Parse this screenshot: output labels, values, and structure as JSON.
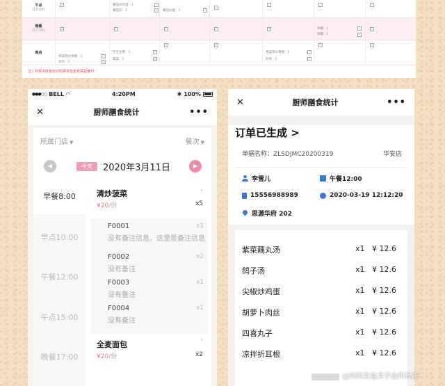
{
  "top_table": {
    "rows": [
      {
        "label": "午点",
        "sub": "(15:00)",
        "pink": false
      },
      {
        "label": "晚餐",
        "sub": "(17:00)",
        "pink": true
      },
      {
        "label": "晚点",
        "sub": "",
        "pink": false
      }
    ],
    "snippets": {
      "r1a": "蕃茄炒鸡蛋：1",
      "r1b": "番茄饮：1",
      "r1c": "番茄炒蛋：1",
      "r2a": "早餐：1",
      "r2b": "早餐：1",
      "r3a": "青菜肉炒青椒：1",
      "r3b": "炒鸡：1",
      "r3c": "天玉豆芽：1",
      "r3d": "蔬菜：1",
      "r3e": "青菜肉炒青椒：1",
      "r3f": "炒青：1"
    },
    "note": "注：列表中红色标识的菜单包含有禁忌食材"
  },
  "left_phone": {
    "status": {
      "carrier": "BELL",
      "time": "4:20PM",
      "battery": "100%"
    },
    "title": "厨师膳食统计",
    "store_filter": "所属门店",
    "meal_filter": "餐次",
    "today_label": "今天",
    "date": "2020年3月11日",
    "meals": [
      "早餐8:00",
      "早点10:00",
      "午餐12:00",
      "午点15:00",
      "晚餐17:00"
    ],
    "dishes": [
      {
        "name": "清炒菠菜",
        "price": "¥20",
        "unit": "/份",
        "qty": "x5",
        "orders": [
          {
            "code": "F0001",
            "note": "没有备注信息，这里是备注信息",
            "qty": "x1"
          },
          {
            "code": "F0002",
            "note": "没有备注",
            "qty": "x2"
          },
          {
            "code": "F0003",
            "note": "没有备注",
            "qty": "x1"
          },
          {
            "code": "F0004",
            "note": "没有备注",
            "qty": "x1"
          }
        ]
      },
      {
        "name": "全麦面包",
        "price": "¥20",
        "unit": "/份",
        "qty": "x2"
      }
    ]
  },
  "right_phone": {
    "title": "厨师膳食统计",
    "heading": "订单已生成 >",
    "order_label": "单据名称：",
    "order_no": "ZLSDJMC20200319",
    "store": "华安店",
    "customer": "李雪儿",
    "meal": "午餐12:00",
    "phone": "15556988989",
    "datetime": "2020-03-19   12:12:20",
    "address": "思源华府 202",
    "items": [
      {
        "name": "紫菜藕丸汤",
        "qty": "x1",
        "price": "¥ 12.6"
      },
      {
        "name": "鸽子汤",
        "qty": "x1",
        "price": "¥ 12.6"
      },
      {
        "name": "尖椒炒鸡蛋",
        "qty": "x1",
        "price": "¥ 12.6"
      },
      {
        "name": "胡萝卜肉丝",
        "qty": "x1",
        "price": "¥ 12.6"
      },
      {
        "name": "四喜丸子",
        "qty": "x1",
        "price": "¥ 12.6"
      },
      {
        "name": "凉拌折耳根",
        "qty": "x1",
        "price": "¥ 12.6"
      }
    ]
  },
  "watermark": "@妈妈宝盒月子会所系统",
  "colors": {
    "accent_pink": "#f19bb7",
    "price_red": "#e7797e",
    "icon_blue": "#3a78d8",
    "note_red": "#e24b4b"
  }
}
